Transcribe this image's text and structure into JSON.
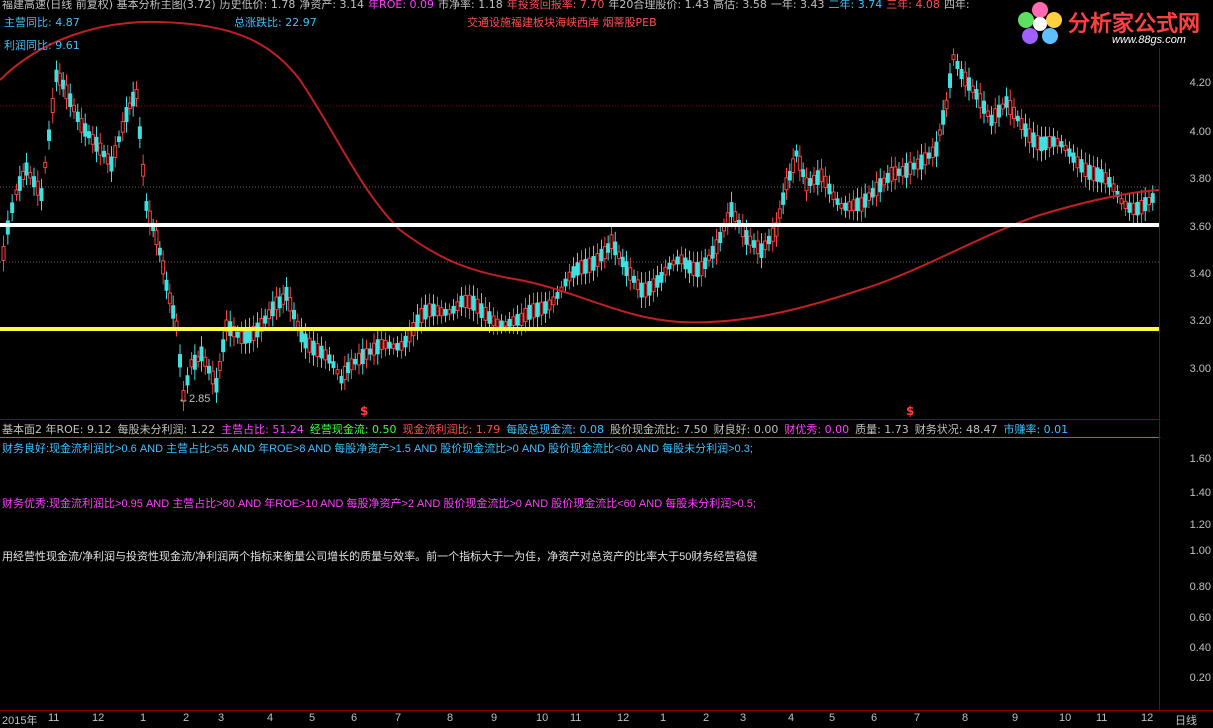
{
  "header": {
    "row1": [
      {
        "t": "福建高速(日线 前复权) 基本分析主图(3.72)",
        "c": "#c0c0c0"
      },
      {
        "t": "历史低价: 1.78",
        "c": "#c0c0c0"
      },
      {
        "t": "净资产: 3.14",
        "c": "#c0c0c0"
      },
      {
        "t": "年ROE: 0.09",
        "c": "#ff40ff"
      },
      {
        "t": "市净率: 1.18",
        "c": "#c0c0c0"
      },
      {
        "t": "年投资回报率: 7.70",
        "c": "#ff5050"
      },
      {
        "t": "年20合理股价: 1.43",
        "c": "#c0c0c0"
      },
      {
        "t": "高估: 3.58",
        "c": "#c0c0c0"
      },
      {
        "t": "一年: 3.43",
        "c": "#c0c0c0"
      },
      {
        "t": "二年: 3.74",
        "c": "#40c0ff"
      },
      {
        "t": "三年: 4.08",
        "c": "#ff5050"
      },
      {
        "t": "四年:",
        "c": "#c0c0c0"
      }
    ],
    "row2_left": {
      "label": "主营同比: 4.87",
      "color": "#40c0ff"
    },
    "row2_mid": {
      "label": "总涨跌比: 22.97",
      "color": "#40c0ff"
    },
    "row2_right": {
      "label": "交通设施福建板块海峡西岸 烟蒂股PEB",
      "color": "#ff5050"
    },
    "row3_left": {
      "label": "利润同比: 9.61",
      "color": "#40c0ff"
    }
  },
  "logo": {
    "text": "分析家公式网",
    "url": "www.88gs.com"
  },
  "price_axis": [
    "4.20",
    "4.00",
    "3.80",
    "3.60",
    "3.40",
    "3.20",
    "3.00"
  ],
  "low_marker": "2.85",
  "markers": [
    "$",
    "$"
  ],
  "sub_header": [
    {
      "t": "基本面2 年ROE: 9.12",
      "c": "#c0c0c0"
    },
    {
      "t": "每股未分利润: 1.22",
      "c": "#c0c0c0"
    },
    {
      "t": "主营占比: 51.24",
      "c": "#ff40ff"
    },
    {
      "t": "经营现金流: 0.50",
      "c": "#40ff40"
    },
    {
      "t": "现金流利润比: 1.79",
      "c": "#ff5050"
    },
    {
      "t": "每股总现金流: 0.08",
      "c": "#40c0ff"
    },
    {
      "t": "股价现金流比: 7.50",
      "c": "#c0c0c0"
    },
    {
      "t": "财良好: 0.00",
      "c": "#c0c0c0"
    },
    {
      "t": "财优秀: 0.00",
      "c": "#ff40ff"
    },
    {
      "t": "质量: 1.73",
      "c": "#c0c0c0"
    },
    {
      "t": "财务状况: 48.47",
      "c": "#c0c0c0"
    },
    {
      "t": "市赚率: 0.01",
      "c": "#40c0ff"
    }
  ],
  "sub_lines": [
    {
      "t": "财务良好:现金流利润比>0.6 AND 主营占比>55 AND 年ROE>8 AND 每股净资产>1.5 AND 股价现金流比>0 AND 股价现金流比<60 AND 每股未分利润>0.3;",
      "c": "#40c0ff"
    },
    {
      "t": "财务优秀:现金流利润比>0.95 AND 主营占比>80 AND 年ROE>10 AND 每股净资产>2 AND 股价现金流比>0 AND 股价现金流比<60 AND 每股未分利润>0.5;",
      "c": "#ff40ff"
    },
    {
      "t": "用经营性现金流/净利润与投资性现金流/净利润两个指标来衡量公司增长的质量与效率。前一个指标大于一为佳，净资产对总资产的比率大于50财务经营稳健",
      "c": "#e0e0e0"
    }
  ],
  "sub_axis": [
    "1.60",
    "1.40",
    "1.20",
    "1.00",
    "0.80",
    "0.60",
    "0.40",
    "0.20"
  ],
  "date_axis": [
    "2015年",
    "11",
    "12",
    "1",
    "2",
    "3",
    "4",
    "5",
    "6",
    "7",
    "8",
    "9",
    "10",
    "11",
    "12",
    "1",
    "2",
    "3",
    "4",
    "5",
    "6",
    "7",
    "8",
    "9",
    "10",
    "11",
    "12",
    "日线"
  ]
}
